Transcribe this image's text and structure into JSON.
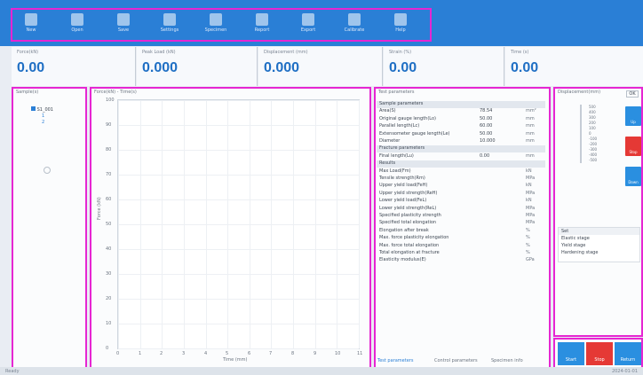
{
  "toolbar": {
    "tools": [
      {
        "label": "New",
        "icon": "new-file-icon"
      },
      {
        "label": "Open",
        "icon": "folder-icon"
      },
      {
        "label": "Save",
        "icon": "save-icon"
      },
      {
        "label": "Settings",
        "icon": "gear-icon"
      },
      {
        "label": "Specimen",
        "icon": "specimen-icon"
      },
      {
        "label": "Report",
        "icon": "report-icon"
      },
      {
        "label": "Export",
        "icon": "export-icon"
      },
      {
        "label": "Calibrate",
        "icon": "calibrate-icon"
      },
      {
        "label": "Help",
        "icon": "help-icon"
      }
    ]
  },
  "readouts": [
    {
      "title": "Force(kN)",
      "value": "0.00"
    },
    {
      "title": "Peak Load (kN)",
      "value": "0.000"
    },
    {
      "title": "Displacement (mm)",
      "value": "0.000"
    },
    {
      "title": "Strain (%)",
      "value": "0.00"
    },
    {
      "title": "Time (s)",
      "value": "0.00"
    }
  ],
  "left_panel": {
    "header": "Sample(s)",
    "tree_root": "S1_001",
    "tree_child_a": "1",
    "tree_child_b": "2"
  },
  "plot": {
    "title": "Force(kN) - Time(s)",
    "ylabel": "Force (kN)",
    "xlabel": "Time (mm)",
    "yticks": [
      "100",
      "90",
      "80",
      "70",
      "60",
      "50",
      "40",
      "30",
      "20",
      "10",
      "0"
    ],
    "xticks": [
      "0",
      "1",
      "2",
      "3",
      "4",
      "5",
      "6",
      "7",
      "8",
      "9",
      "10",
      "11"
    ]
  },
  "params": {
    "header": "Test parameters",
    "rows": [
      {
        "name": "Sample parameters",
        "value": "",
        "unit": "",
        "section": true
      },
      {
        "name": "Area(S)",
        "value": "78.54",
        "unit": "mm²"
      },
      {
        "name": "Original gauge length(Lo)",
        "value": "50.00",
        "unit": "mm"
      },
      {
        "name": "Parallel length(Lc)",
        "value": "60.00",
        "unit": "mm"
      },
      {
        "name": "Extensometer gauge length(Le)",
        "value": "50.00",
        "unit": "mm"
      },
      {
        "name": "Diameter",
        "value": "10.000",
        "unit": "mm"
      },
      {
        "name": "Fracture parameters",
        "value": "",
        "unit": "",
        "section": true
      },
      {
        "name": "Final length(Lu)",
        "value": "0.00",
        "unit": "mm"
      },
      {
        "name": "Results",
        "value": "",
        "unit": "",
        "section": true
      },
      {
        "name": "Max Load(Fm)",
        "value": "",
        "unit": "kN"
      },
      {
        "name": "Tensile strength(Rm)",
        "value": "",
        "unit": "MPa"
      },
      {
        "name": "Upper yield load(FeH)",
        "value": "",
        "unit": "kN"
      },
      {
        "name": "Upper yield strength(ReH)",
        "value": "",
        "unit": "MPa"
      },
      {
        "name": "Lower yield load(FeL)",
        "value": "",
        "unit": "kN"
      },
      {
        "name": "Lower yield strength(ReL)",
        "value": "",
        "unit": "MPa"
      },
      {
        "name": "Specified plasticity strength",
        "value": "",
        "unit": "MPa"
      },
      {
        "name": "Specified total elongation",
        "value": "",
        "unit": "MPa"
      },
      {
        "name": "Elongation after break",
        "value": "",
        "unit": "%"
      },
      {
        "name": "Max. force plasticity elongation",
        "value": "",
        "unit": "%"
      },
      {
        "name": "Max. force total elongation",
        "value": "",
        "unit": "%"
      },
      {
        "name": "Total elongation at fracture",
        "value": "",
        "unit": "%"
      },
      {
        "name": "Elasticity modulus(E)",
        "value": "",
        "unit": "GPa"
      }
    ],
    "tabs": [
      "Test parameters",
      "Control parameters",
      "Specimen info"
    ]
  },
  "right_panel": {
    "header": "Displacement(mm)",
    "ok": "OK",
    "scale": [
      "500",
      "400",
      "300",
      "200",
      "100",
      "0",
      "-100",
      "-200",
      "-300",
      "-400",
      "-500"
    ],
    "list_header": "Set",
    "list": [
      "Elastic stage",
      "Yield stage",
      "Hardening stage"
    ],
    "buttons": [
      {
        "label": "Up",
        "color": "#2a8fe0"
      },
      {
        "label": "Stop",
        "color": "#e53935"
      },
      {
        "label": "Down",
        "color": "#2a8fe0"
      }
    ]
  },
  "bottom_buttons": [
    {
      "label": "Start",
      "color": "#2a8fe0"
    },
    {
      "label": "Stop",
      "color": "#e53935"
    },
    {
      "label": "Return",
      "color": "#2a8fe0"
    }
  ],
  "status": {
    "left": "Ready",
    "right": "2024-01-01"
  }
}
